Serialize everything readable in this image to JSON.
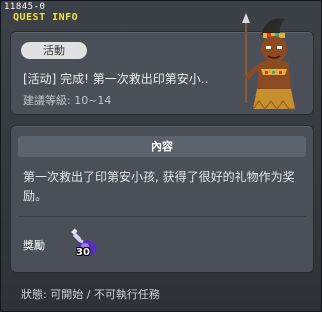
{
  "window": {
    "quest_id": "11845-0",
    "title": "QUEST INFO"
  },
  "summary": {
    "category": "活動",
    "quest_name": "[活动] 完成! 第一次救出印第安小..",
    "required_level": "建議等級: 10~14"
  },
  "details": {
    "section_title": "內容",
    "description": "第一次救出了印第安小孩, 获得了很好的礼物作为奖励。",
    "reward_label": "獎勵",
    "reward_item_icon": "purple-potion-icon",
    "reward_quantity": "30"
  },
  "status": {
    "text": "狀態: 可開始 / 不可執行任務"
  },
  "colors": {
    "title_yellow": "#f2e04a",
    "panel_bg": "#4b5058",
    "window_bg": "#3d4148"
  }
}
